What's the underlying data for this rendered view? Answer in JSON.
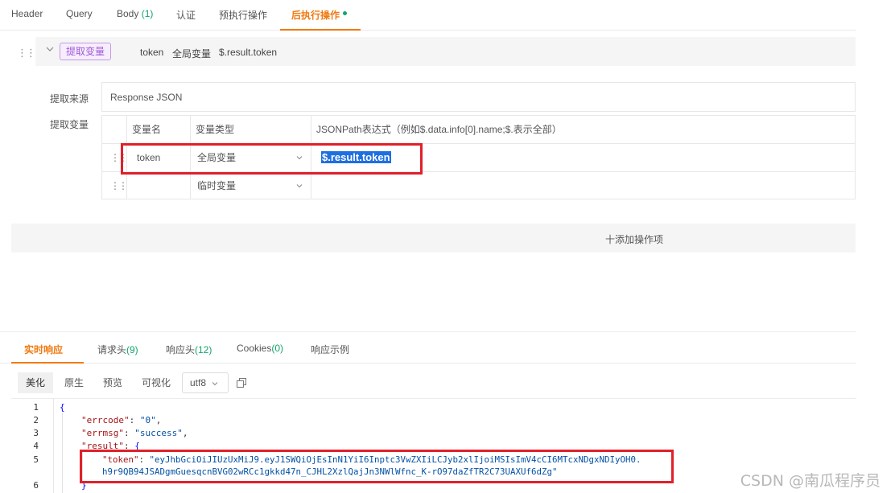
{
  "top_tabs": [
    {
      "label": "Header",
      "count": ""
    },
    {
      "label": "Query",
      "count": ""
    },
    {
      "label": "Body",
      "count": "(1)"
    },
    {
      "label": "认证",
      "count": ""
    },
    {
      "label": "预执行操作",
      "count": ""
    },
    {
      "label": "后执行操作",
      "count": "",
      "active": true
    }
  ],
  "operation": {
    "tag": "提取变量",
    "summary_var": "token",
    "summary_type": "全局变量",
    "summary_path": "$.result.token"
  },
  "form": {
    "source_label": "提取来源",
    "source_value": "Response JSON",
    "vars_label": "提取变量"
  },
  "var_table": {
    "headers": [
      "变量名",
      "变量类型",
      "JSONPath表达式（例如$.data.info[0].name;$.表示全部）"
    ],
    "rows": [
      {
        "name": "token",
        "type": "全局变量",
        "path": "$.result.token"
      },
      {
        "name": "",
        "type": "临时变量",
        "path": ""
      }
    ]
  },
  "add_action_label": "十添加操作项",
  "response_tabs": [
    {
      "label": "实时响应",
      "count": "",
      "active": true
    },
    {
      "label": "请求头",
      "count": "(9)"
    },
    {
      "label": "响应头",
      "count": "(12)"
    },
    {
      "label": "Cookies",
      "count": "(0)"
    },
    {
      "label": "响应示例",
      "count": ""
    }
  ],
  "view_modes": [
    "美化",
    "原生",
    "预览",
    "可视化"
  ],
  "encoding": "utf8",
  "code_lines": {
    "numbers": [
      "1",
      "2",
      "3",
      "4",
      "5",
      "6"
    ],
    "l1": "{",
    "l2_key": "\"errcode\"",
    "l2_val": "\"0\"",
    "l3_key": "\"errmsg\"",
    "l3_val": "\"success\"",
    "l4_key": "\"result\"",
    "l4_brace": "{",
    "l5_key": "\"token\"",
    "l5_val_a": "\"eyJhbGciOiJIUzUxMiJ9.eyJ1SWQiOjEsInN1YiI6Inptc3VwZXIiLCJyb2xlIjoiMSIsImV4cCI6MTcxNDgxNDIyOH0.",
    "l5_val_b": "h9r9QB94JSADgmGuesqcnBVG02wRCc1gkkd47n_CJHL2XzlQajJn3NWlWfnc_K-rO97daZfTR2C73UAXUf6dZg\"",
    "l6": "}"
  },
  "watermark": "CSDN @南瓜程序员"
}
